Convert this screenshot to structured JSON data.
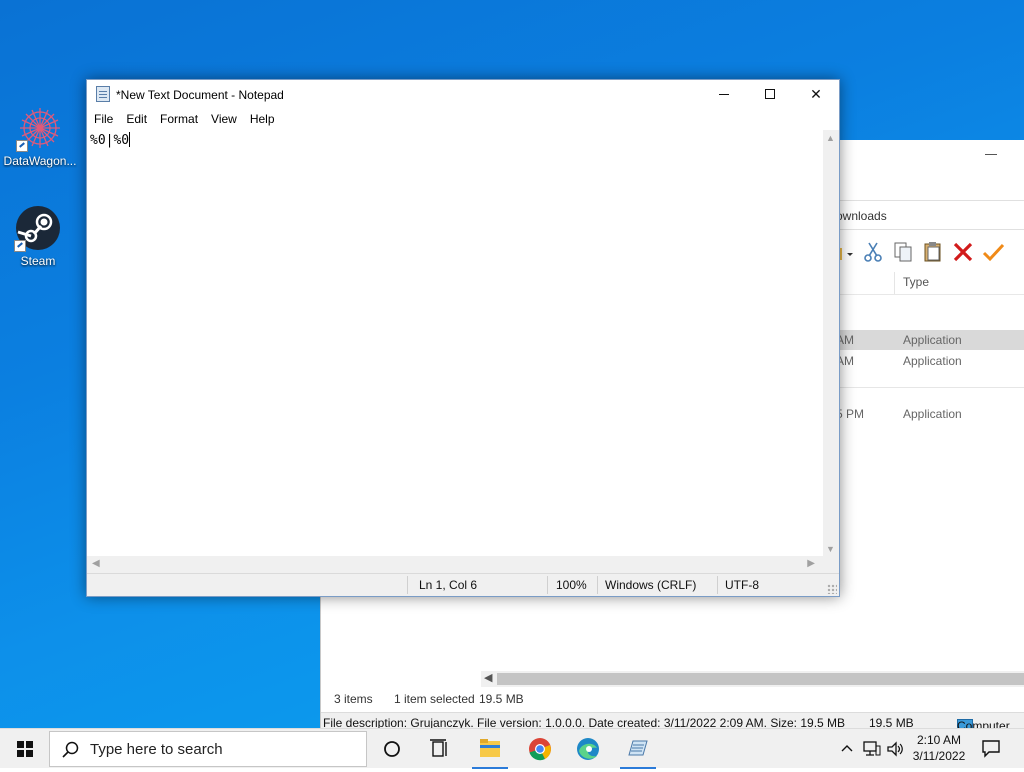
{
  "desktop": {
    "icons": [
      {
        "label": "DataWagon..."
      },
      {
        "label": "Steam"
      }
    ]
  },
  "explorer": {
    "address_fragment": "ownloads",
    "columns": {
      "type": "Type"
    },
    "rows": [
      {
        "time": "AM",
        "type": "Application",
        "selected": true
      },
      {
        "time": "AM",
        "type": "Application",
        "selected": false
      },
      {
        "time": "5 PM",
        "type": "Application",
        "selected": false
      }
    ],
    "status": {
      "items": "3 items",
      "selected": "1 item selected",
      "size": "19.5 MB"
    },
    "details_bar": {
      "description": "File description: Grujanczyk. File version: 1.0.0.0. Date created: 3/11/2022 2:09 AM. Size: 19.5 MB",
      "size": "19.5 MB",
      "location": "Computer"
    }
  },
  "notepad": {
    "title": "*New Text Document - Notepad",
    "menu": [
      "File",
      "Edit",
      "Format",
      "View",
      "Help"
    ],
    "content": "%0|%0",
    "status": {
      "position": "Ln 1, Col 6",
      "zoom": "100%",
      "line_ending": "Windows (CRLF)",
      "encoding": "UTF-8"
    },
    "caption": {
      "close_glyph": "✕"
    }
  },
  "taskbar": {
    "search_placeholder": "Type here to search",
    "clock_time": "2:10 AM",
    "clock_date": "3/11/2022",
    "apps": [
      "task-view",
      "file-explorer",
      "chrome",
      "edge",
      "notepad"
    ],
    "tray_chevron": "^"
  },
  "colors": {
    "accent": "#2b7bd9",
    "desktop": "#0b7fe0"
  }
}
